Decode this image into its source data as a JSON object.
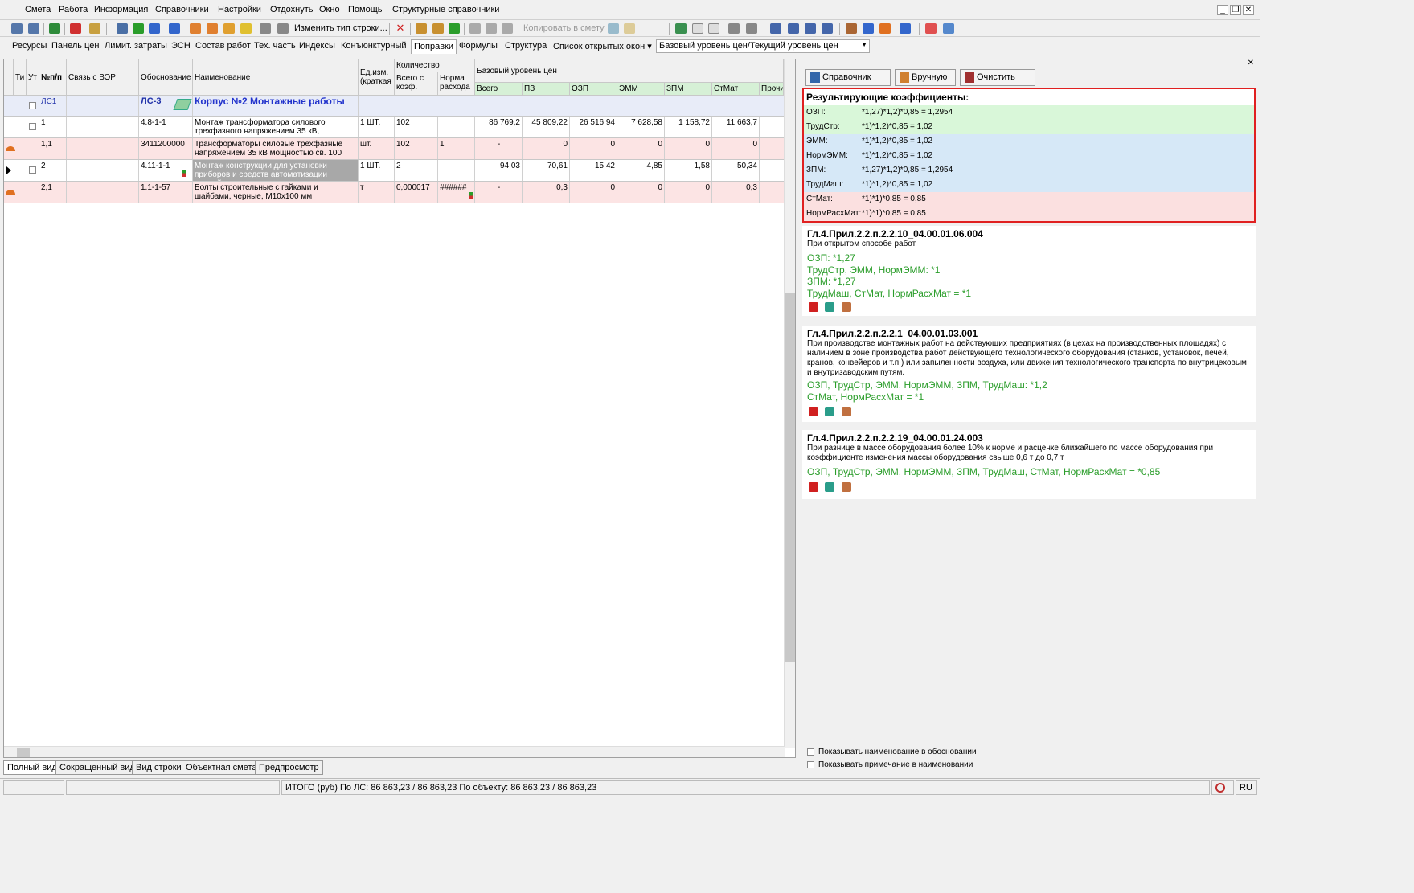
{
  "menu": {
    "items": [
      "Смета",
      "Работа",
      "Информация",
      "Справочники",
      "Настройки",
      "Отдохнуть",
      "Окно",
      "Помощь",
      "Структурные справочники"
    ]
  },
  "toolbar": {
    "change_type_label": "Изменить тип строки...",
    "copy_label": "Копировать в смету"
  },
  "tabs": {
    "items": [
      "Ресурсы",
      "Панель цен",
      "Лимит. затраты",
      "ЭСН",
      "Состав работ",
      "Тех. часть",
      "Индексы",
      "Конъюнктурный",
      "Поправки",
      "Формулы",
      "Структура",
      "Список открытых окон ▾"
    ],
    "active": "Поправки",
    "level_select": "Базовый уровень цен/Текущий уровень цен"
  },
  "grid": {
    "headers": {
      "ti": "Ти",
      "ut": "Ут",
      "num": "№п/п",
      "vor": "Связь с ВОР",
      "basis": "Обоснование",
      "name": "Наименование",
      "unit": "Ед.изм. (краткая",
      "qty": "Количество",
      "qty_total": "Всего с коэф.",
      "norm": "Норма расхода",
      "base_level": "Базовый уровень цен",
      "all": "Всего",
      "pz": "ПЗ",
      "ozp": "ОЗП",
      "emm": "ЭММ",
      "zpm": "ЗПМ",
      "stmat": "СтМат",
      "other": "Прочи"
    },
    "rows": [
      {
        "num": "ЛС1",
        "basis": "ЛС-3",
        "name": "Корпус №2 Монтажные работы",
        "unit": "",
        "qty": "",
        "norm": "",
        "all": "",
        "pz": "",
        "ozp": "",
        "emm": "",
        "zpm": "",
        "stmat": ""
      },
      {
        "num": "1",
        "basis": "4.8-1-1",
        "name": "Монтаж трансформатора силового трехфазного напряжением 35 кВ,",
        "unit": "1 ШТ.",
        "qty": "102",
        "norm": "",
        "all": "86 769,2",
        "pz": "45 809,22",
        "ozp": "26 516,94",
        "emm": "7 628,58",
        "zpm": "1 158,72",
        "stmat": "11 663,7"
      },
      {
        "num": "1,1",
        "basis": "3411200000",
        "name": "Трансформаторы силовые трехфазные напряжением 35 кВ мощностью св. 100",
        "unit": "шт.",
        "qty": "102",
        "norm": "1",
        "all": "-",
        "pz": "0",
        "ozp": "0",
        "emm": "0",
        "zpm": "0",
        "stmat": "0"
      },
      {
        "num": "2",
        "basis": "4.11-1-1",
        "name": "Монтаж конструкции для установки приборов и средств автоматизации массой",
        "unit": "1 ШТ.",
        "qty": "2",
        "norm": "",
        "all": "94,03",
        "pz": "70,61",
        "ozp": "15,42",
        "emm": "4,85",
        "zpm": "1,58",
        "stmat": "50,34"
      },
      {
        "num": "2,1",
        "basis": "1.1-1-57",
        "name": "Болты строительные с гайками и шайбами, черные, М10х100 мм",
        "unit": "т",
        "qty": "0,000017",
        "norm": "######",
        "all": "-",
        "pz": "0,3",
        "ozp": "0",
        "emm": "0",
        "zpm": "0",
        "stmat": "0,3"
      }
    ]
  },
  "view_tabs": [
    "Полный вид",
    "Сокращенный вид",
    "Вид строки",
    "Объектная смета",
    "Предпросмотр"
  ],
  "status": {
    "total": "ИТОГО (руб)  По ЛС: 86 863,23 / 86 863,23     По объекту: 86 863,23 / 86 863,23",
    "lang": "RU"
  },
  "right": {
    "buttons": {
      "reference": "Справочник",
      "manual": "Вручную",
      "clear": "Очистить"
    },
    "coef_title": "Результирующие коэффициенты:",
    "coefs": [
      {
        "name": "ОЗП:",
        "value": "*1,27)*1,2)*0,85 = 1,2954",
        "color": "#d9f7d9"
      },
      {
        "name": "ТрудСтр:",
        "value": "*1)*1,2)*0,85 = 1,02",
        "color": "#d9f7d9"
      },
      {
        "name": "ЭММ:",
        "value": "*1)*1,2)*0,85 = 1,02",
        "color": "#d6e8f7"
      },
      {
        "name": "НормЭММ:",
        "value": "*1)*1,2)*0,85 = 1,02",
        "color": "#d6e8f7"
      },
      {
        "name": "ЗПМ:",
        "value": "*1,27)*1,2)*0,85 = 1,2954",
        "color": "#d6e8f7"
      },
      {
        "name": "ТрудМаш:",
        "value": "*1)*1,2)*0,85 = 1,02",
        "color": "#d6e8f7"
      },
      {
        "name": "СтМат:",
        "value": "*1)*1)*0,85 = 0,85",
        "color": "#fbe0e0"
      },
      {
        "name": "НормРасхМат:",
        "value": "*1)*1)*0,85 = 0,85",
        "color": "#fbe0e0"
      }
    ],
    "cards": [
      {
        "title": "Гл.4.Прил.2.2.п.2.2.10_04.00.01.06.004",
        "desc": "При открытом способе работ",
        "lines": [
          "ОЗП: *1,27",
          "ТрудСтр, ЭММ, НормЭММ: *1",
          "ЗПМ: *1,27",
          "ТрудМаш, СтМат, НормРасхМат = *1"
        ]
      },
      {
        "title": "Гл.4.Прил.2.2.п.2.2.1_04.00.01.03.001",
        "desc": "При производстве монтажных работ на действующих предприятиях (в цехах на производственных площадях) с наличием в зоне производства работ действующего технологического оборудования (станков, установок, печей, кранов, конвейеров и т.п.) или запыленности воздуха, или движения технологического транспорта по внутрицеховым и внутризаводским путям.",
        "lines": [
          "ОЗП, ТрудСтр, ЭММ, НормЭММ, ЗПМ, ТрудМаш: *1,2",
          "СтМат, НормРасхМат = *1"
        ]
      },
      {
        "title": "Гл.4.Прил.2.2.п.2.2.19_04.00.01.24.003",
        "desc": "При разнице в массе оборудования более 10% к норме и расценке ближайшего по массе оборудования при коэффициенте изменения массы оборудования свыше 0,6 т до 0,7 т",
        "lines": [
          "ОЗП, ТрудСтр, ЭММ, НормЭММ, ЗПМ, ТрудМаш, СтМат, НормРасхМат = *0,85"
        ]
      }
    ],
    "check1": "Показывать наименование в обосновании",
    "check2": "Показывать примечание в наименовании"
  }
}
